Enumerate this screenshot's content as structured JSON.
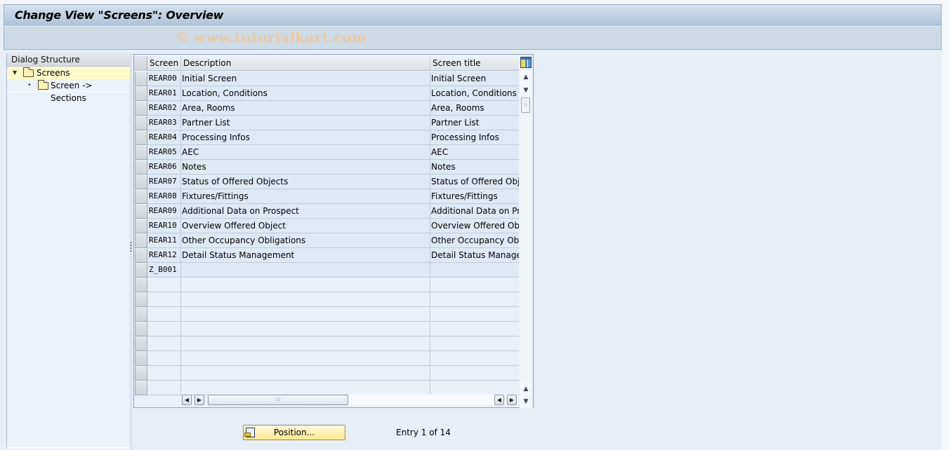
{
  "window": {
    "title": "Change View \"Screens\": Overview",
    "watermark": "© www.tutorialkart.com"
  },
  "dialog_structure": {
    "header": "Dialog Structure",
    "items": [
      {
        "label": "Screens",
        "expanded": true,
        "selected": true,
        "icon": "folder-open-icon"
      },
      {
        "label": "Screen -> Sections",
        "selected": false,
        "icon": "folder-icon"
      }
    ]
  },
  "table": {
    "columns": [
      "Screen",
      "Description",
      "Screen title"
    ],
    "rows": [
      {
        "screen": "REAR00",
        "description": "Initial Screen",
        "title": "Initial Screen"
      },
      {
        "screen": "REAR01",
        "description": "Location, Conditions",
        "title": "Location, Conditions"
      },
      {
        "screen": "REAR02",
        "description": "Area, Rooms",
        "title": "Area, Rooms"
      },
      {
        "screen": "REAR03",
        "description": "Partner List",
        "title": "Partner List"
      },
      {
        "screen": "REAR04",
        "description": "Processing Infos",
        "title": "Processing Infos"
      },
      {
        "screen": "REAR05",
        "description": "AEC",
        "title": "AEC"
      },
      {
        "screen": "REAR06",
        "description": "Notes",
        "title": "Notes"
      },
      {
        "screen": "REAR07",
        "description": "Status of Offered Objects",
        "title": "Status of Offered Objects"
      },
      {
        "screen": "REAR08",
        "description": "Fixtures/Fittings",
        "title": "Fixtures/Fittings"
      },
      {
        "screen": "REAR09",
        "description": "Additional Data on Prospect",
        "title": "Additional Data on Prospect"
      },
      {
        "screen": "REAR10",
        "description": "Overview Offered Object",
        "title": "Overview Offered Object"
      },
      {
        "screen": "REAR11",
        "description": "Other Occupancy Obligations",
        "title": "Other Occupancy Obligations"
      },
      {
        "screen": "REAR12",
        "description": "Detail Status Management",
        "title": "Detail Status Management"
      },
      {
        "screen": "Z_B001",
        "description": "",
        "title": ""
      }
    ],
    "empty_rows": 8
  },
  "footer": {
    "position_button": "Position...",
    "entry_info": "Entry 1 of 14"
  }
}
